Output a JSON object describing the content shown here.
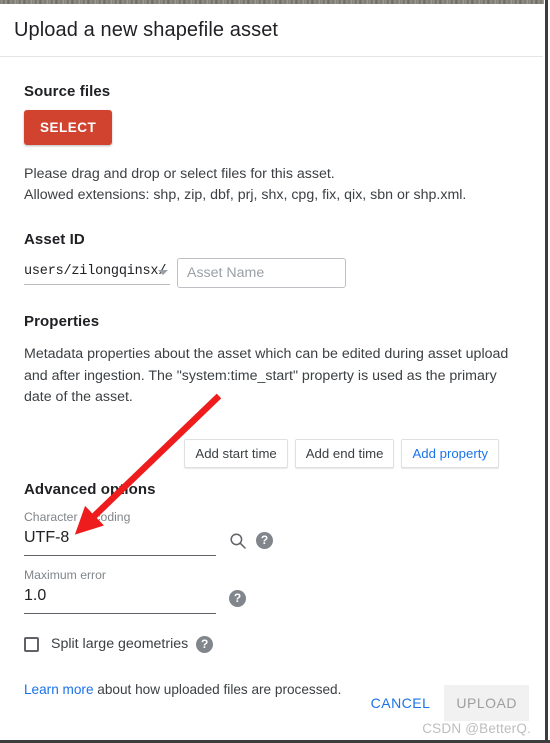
{
  "dialog": {
    "title": "Upload a new shapefile asset"
  },
  "source_files": {
    "heading": "Source files",
    "select_button": "SELECT",
    "hint_line_1": "Please drag and drop or select files for this asset.",
    "hint_line_2": "Allowed extensions: shp, zip, dbf, prj, shx, cpg, fix, qix, sbn or shp.xml."
  },
  "asset_id": {
    "heading": "Asset ID",
    "prefix_value": "users/zilongqinsx/",
    "name_placeholder": "Asset Name",
    "name_value": ""
  },
  "properties": {
    "heading": "Properties",
    "description": "Metadata properties about the asset which can be edited during asset upload and after ingestion. The \"system:time_start\" property is used as the primary date of the asset.",
    "buttons": [
      {
        "label": "Add start time",
        "style": "default"
      },
      {
        "label": "Add end time",
        "style": "default"
      },
      {
        "label": "Add property",
        "style": "link"
      }
    ]
  },
  "advanced_options": {
    "heading": "Advanced options",
    "character_encoding": {
      "label": "Character encoding",
      "value": "UTF-8",
      "search_icon": "search-icon",
      "help_icon": "help-icon"
    },
    "maximum_error": {
      "label": "Maximum error",
      "value": "1.0",
      "help_icon": "help-icon"
    },
    "split_large_geometries": {
      "label": "Split large geometries",
      "checked": false,
      "help_icon": "help-icon"
    },
    "help_glyph": "?"
  },
  "footer": {
    "learn_more_link": "Learn more",
    "learn_more_rest": " about how uploaded files are processed.",
    "cancel_label": "CANCEL",
    "upload_label": "UPLOAD"
  },
  "watermark": {
    "text": "CSDN @BetterQ."
  },
  "annotation": {
    "type": "arrow",
    "color": "#ee1c1c",
    "points_at": "character-encoding-field"
  },
  "colors": {
    "select_red": "#d2432f",
    "link_blue": "#1a73e8",
    "annotation_red": "#ee1c1c",
    "text_primary": "#202124",
    "text_secondary": "#3c4043",
    "label_gray": "#80868b"
  }
}
